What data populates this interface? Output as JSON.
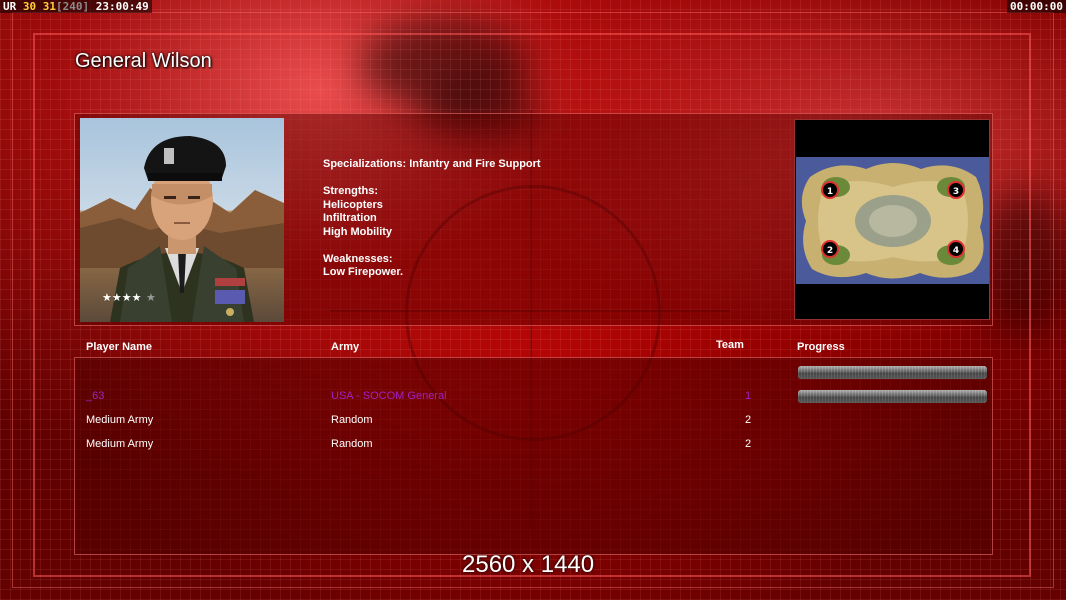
{
  "hud": {
    "label": "UR",
    "fps_a": "30",
    "fps_b": "31",
    "fps_cap": "[240]",
    "time_left": "23:00:49",
    "time_right": "00:00:00"
  },
  "general": {
    "title": "General Wilson"
  },
  "description": {
    "specializations": "Specializations: Infantry and Fire Support",
    "strengths_heading": "Strengths:",
    "strengths": [
      "Helicopters",
      "Infiltration",
      "High Mobility"
    ],
    "weaknesses_heading": "Weaknesses:",
    "weaknesses": [
      "Low Firepower."
    ]
  },
  "minimap": {
    "start_positions": [
      "1",
      "2",
      "3",
      "4"
    ]
  },
  "player_table": {
    "headers": {
      "player_name": "Player Name",
      "army": "Army",
      "team": "Team",
      "progress": "Progress"
    },
    "rows": [
      {
        "name": "",
        "army": "",
        "team": "",
        "color": "#8a0a0a",
        "progress": 1.0
      },
      {
        "name": "_63",
        "army": "USA - SOCOM General",
        "team": "1",
        "color": "#a020c8",
        "progress": 1.0
      },
      {
        "name": "Medium Army",
        "army": "Random",
        "team": "2",
        "color": "#ffffff",
        "progress": null
      },
      {
        "name": "Medium Army",
        "army": "Random",
        "team": "2",
        "color": "#ffffff",
        "progress": null
      }
    ]
  },
  "resolution_overlay": "2560 x 1440",
  "colors": {
    "background": "#6a0000",
    "accent": "#ff5050",
    "player_purple": "#a020c8"
  }
}
